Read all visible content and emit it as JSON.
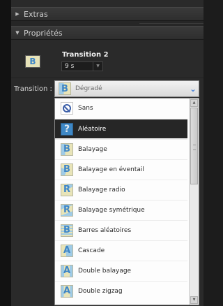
{
  "panel": {
    "extras_header": "Extras",
    "properties_header": "Propriétés"
  },
  "current_transition": {
    "name": "Transition 2",
    "duration": "9 s",
    "thumb_icon": "dynamic-wipe-icon",
    "thumb_glyph": "B"
  },
  "transition_select": {
    "label": "Transition :",
    "value": "Dégradé",
    "value_glyph": "B",
    "value_icon": "fade-icon"
  },
  "dropdown": {
    "items": [
      {
        "label": "Sans",
        "icon": "no-symbol-icon",
        "glyph": ""
      },
      {
        "label": "Aléatoire",
        "icon": "question-mark-icon",
        "glyph": "?",
        "selected": true
      },
      {
        "label": "Balayage",
        "icon": "wipe-icon",
        "glyph": "B"
      },
      {
        "label": "Balayage en éventail",
        "icon": "fan-wipe-icon",
        "glyph": "B"
      },
      {
        "label": "Balayage radio",
        "icon": "radial-wipe-icon",
        "glyph": "R"
      },
      {
        "label": "Balayage symétrique",
        "icon": "symmetric-wipe-icon",
        "glyph": "R"
      },
      {
        "label": "Barres aléatoires",
        "icon": "random-bars-icon",
        "glyph": "B"
      },
      {
        "label": "Cascade",
        "icon": "cascade-icon",
        "glyph": "A"
      },
      {
        "label": "Double balayage",
        "icon": "double-wipe-icon",
        "glyph": "A"
      },
      {
        "label": "Double zigzag",
        "icon": "double-zigzag-icon",
        "glyph": "A"
      }
    ]
  },
  "colors": {
    "panel_bg": "#2a2a2a",
    "list_bg": "#fdfdfd",
    "selected_row": "#262626",
    "thumb_blue": "#3f86c6",
    "thumb_cream": "#e8e4b8"
  }
}
